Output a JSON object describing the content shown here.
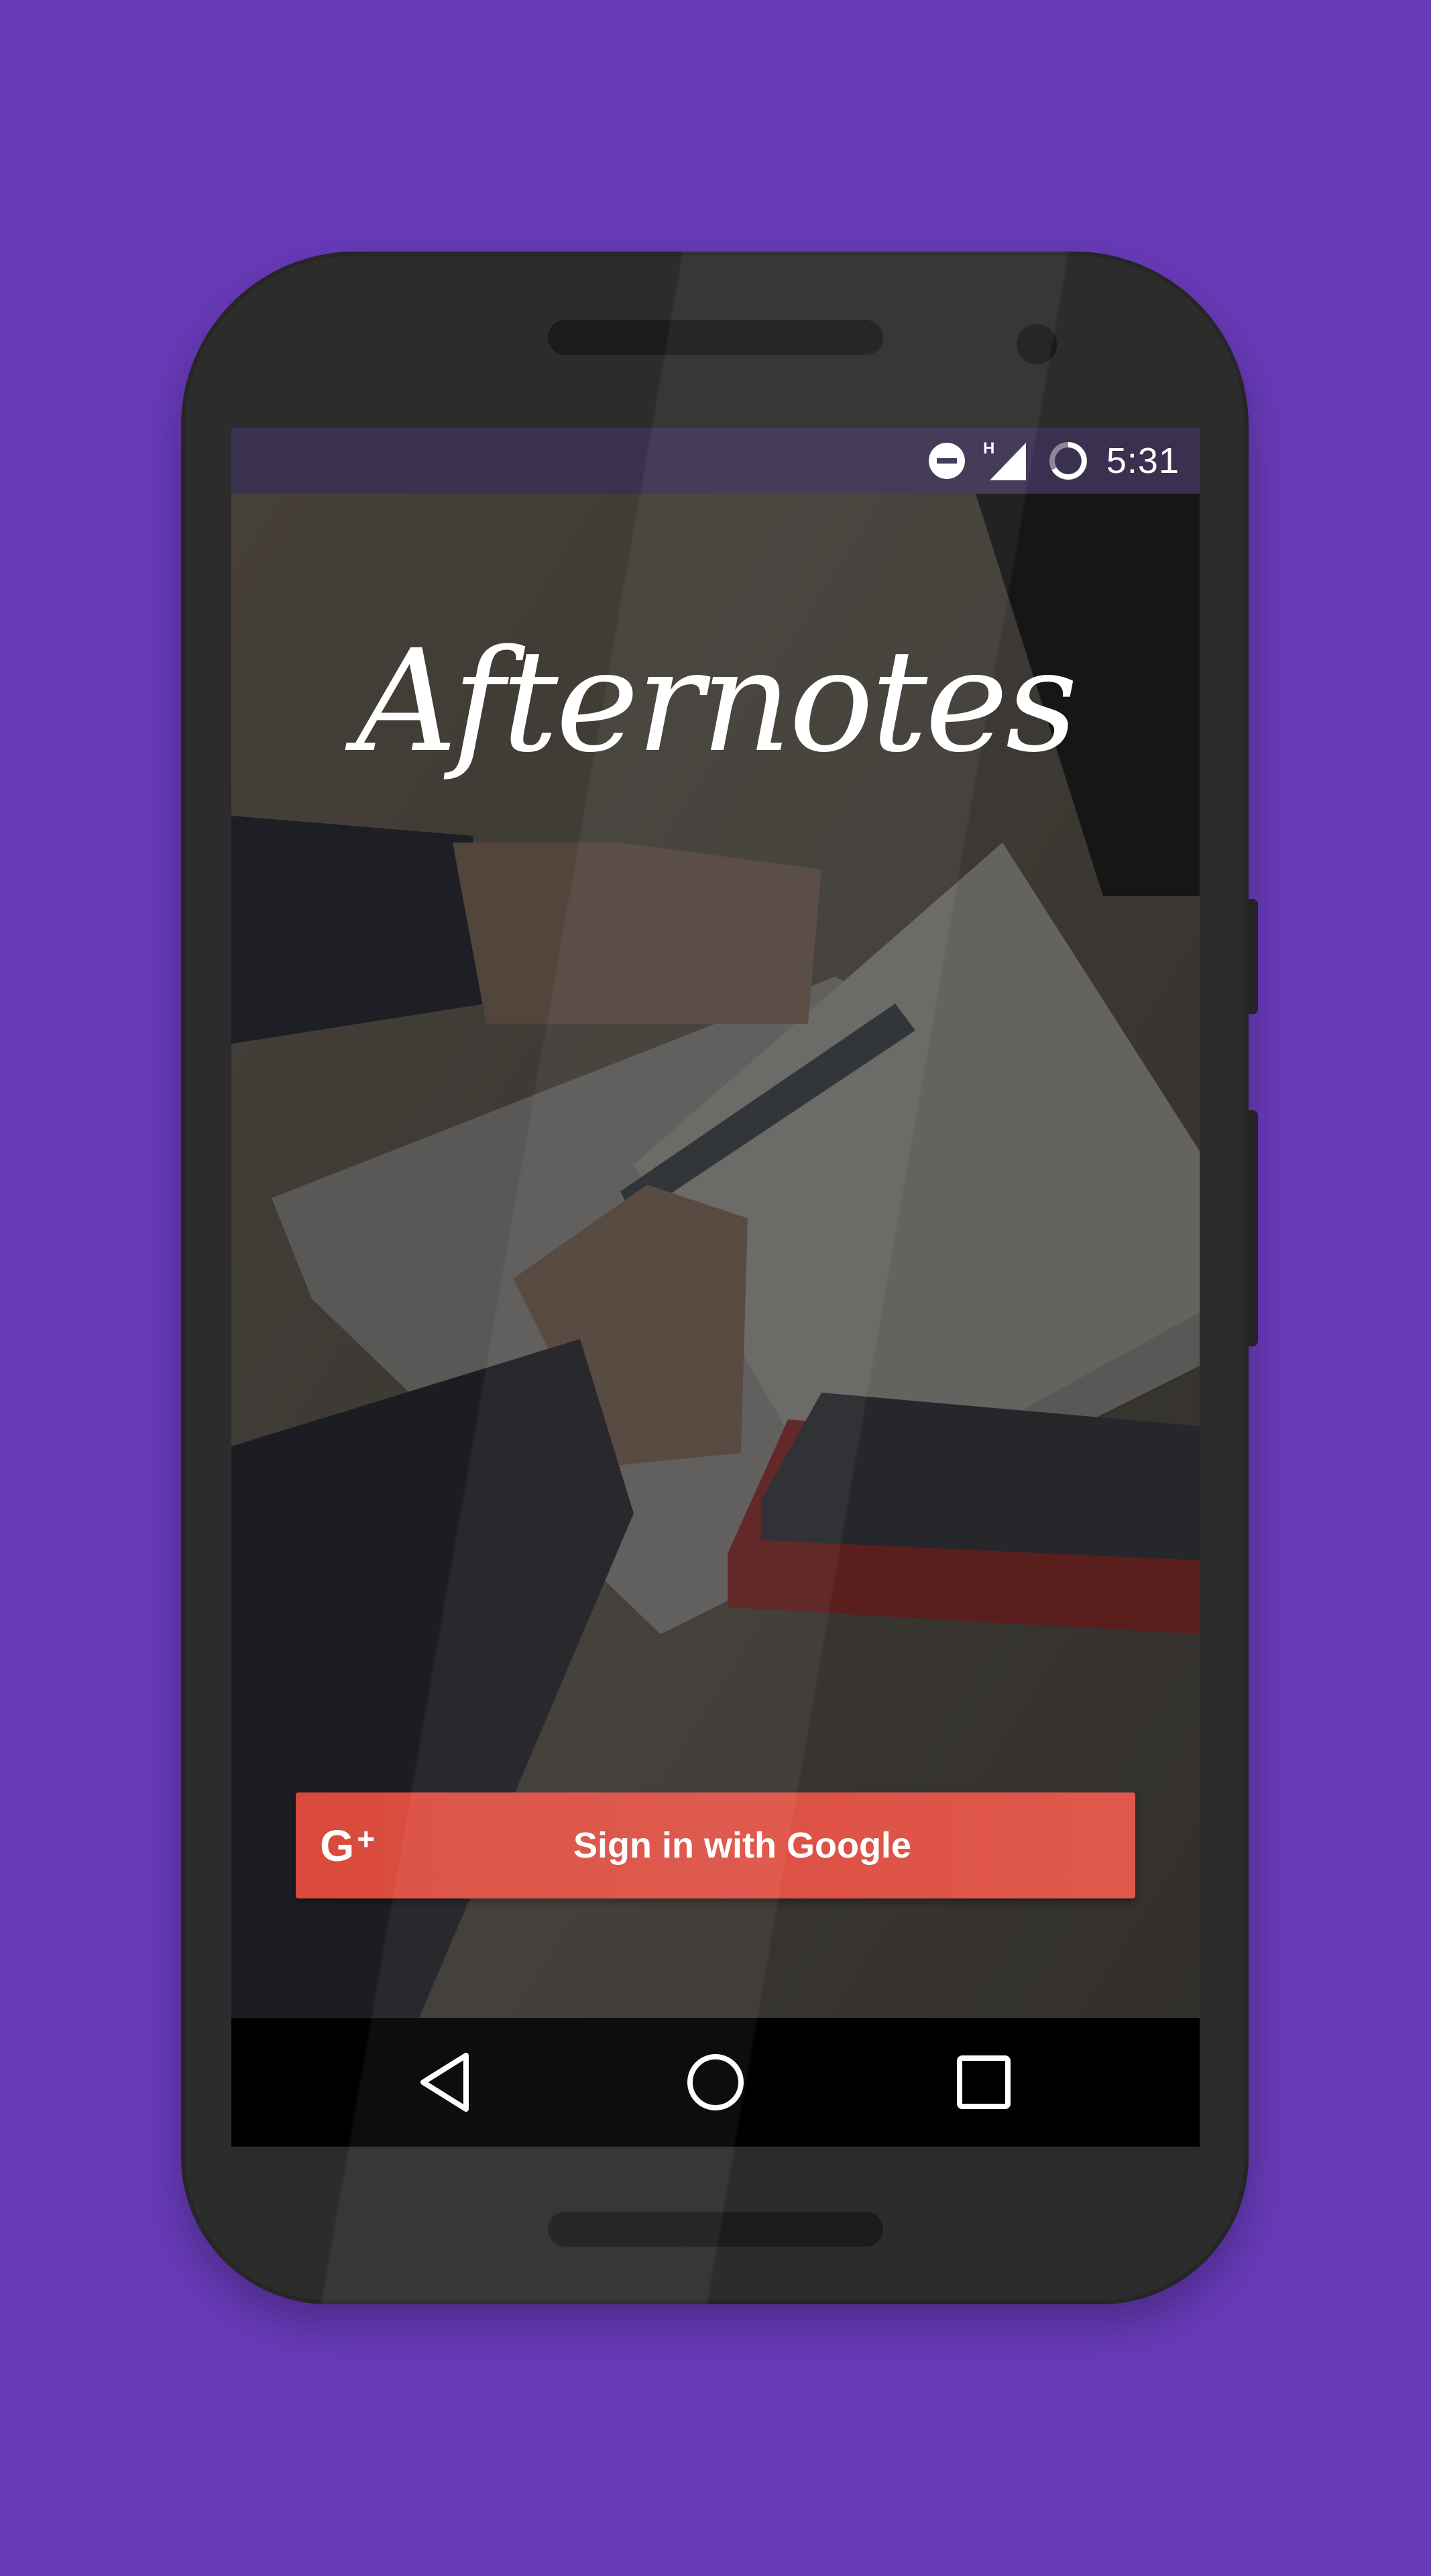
{
  "status_bar": {
    "time": "5:31",
    "network_type": "H",
    "icons": [
      "do-not-disturb-icon",
      "signal-icon",
      "battery-charging-icon"
    ]
  },
  "app": {
    "logo_text": "Afternotes"
  },
  "sign_in": {
    "icon": "google-plus-icon",
    "icon_text": "G",
    "label": "Sign in with Google"
  },
  "navigation": {
    "buttons": [
      "back-icon",
      "home-icon",
      "recents-icon"
    ]
  },
  "colors": {
    "background": "#673AB7",
    "button": "#DD4B39",
    "status_bar": "#3A3150"
  }
}
